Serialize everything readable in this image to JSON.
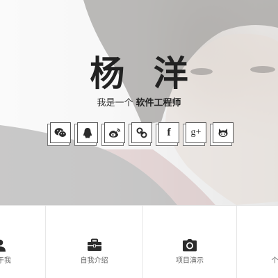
{
  "hero": {
    "name": "杨 洋",
    "tagline_prefix": "我是一个",
    "tagline_role": "软件工程师",
    "socials": [
      {
        "name": "wechat-icon"
      },
      {
        "name": "qq-icon"
      },
      {
        "name": "weibo-icon"
      },
      {
        "name": "link-icon"
      },
      {
        "name": "facebook-icon",
        "glyph": "f"
      },
      {
        "name": "google-plus-icon",
        "glyph": "g+"
      },
      {
        "name": "github-icon"
      }
    ]
  },
  "nav": {
    "items": [
      {
        "label": "关于我",
        "label_visible": "于我",
        "icon": "user-icon"
      },
      {
        "label": "自我介绍",
        "icon": "briefcase-icon"
      },
      {
        "label": "项目演示",
        "icon": "camera-icon"
      },
      {
        "label": "个",
        "icon": "contact-icon"
      }
    ]
  },
  "colors": {
    "title": "#222222",
    "icon": "#2b2b2b",
    "divider": "#e7e7e7"
  }
}
